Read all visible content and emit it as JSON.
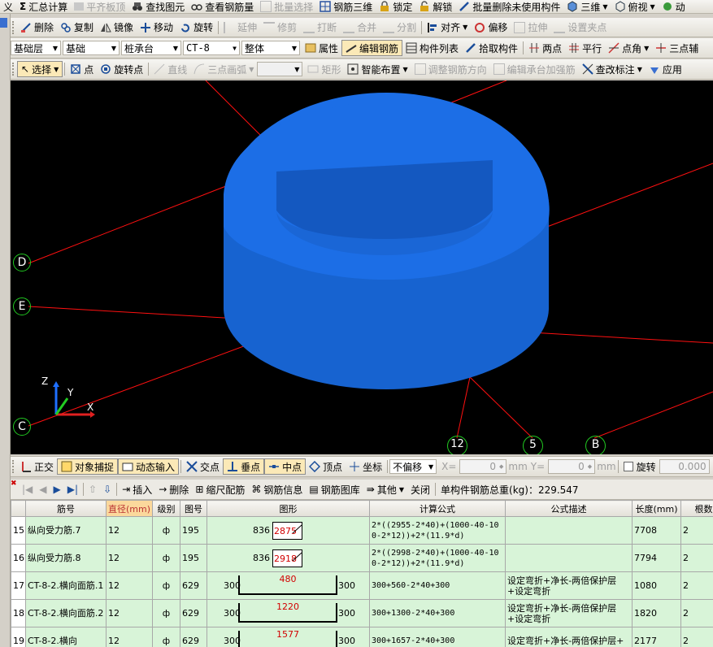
{
  "toolbar1": [
    {
      "label": "义",
      "disabled": false
    },
    {
      "label": "汇总计算",
      "icon": "sigma-icon",
      "disabled": false
    },
    {
      "label": "平齐板顶",
      "disabled": true
    },
    {
      "label": "查找图元",
      "disabled": false
    },
    {
      "label": "查看钢筋量",
      "disabled": false
    },
    {
      "label": "批量选择",
      "disabled": true
    },
    {
      "label": "钢筋三维",
      "disabled": false
    },
    {
      "label": "锁定",
      "disabled": false
    },
    {
      "label": "解锁",
      "disabled": false
    },
    {
      "label": "批量删除未使用构件",
      "disabled": false
    },
    {
      "label": "三维",
      "disabled": false
    },
    {
      "label": "俯视",
      "disabled": false
    },
    {
      "label": "动",
      "disabled": false
    }
  ],
  "toolbar2": [
    {
      "label": "删除",
      "disabled": false
    },
    {
      "label": "复制",
      "disabled": false
    },
    {
      "label": "镜像",
      "disabled": false
    },
    {
      "label": "移动",
      "disabled": false
    },
    {
      "label": "旋转",
      "disabled": false
    },
    {
      "label": "延伸",
      "disabled": true
    },
    {
      "label": "修剪",
      "disabled": true
    },
    {
      "label": "打断",
      "disabled": true
    },
    {
      "label": "合并",
      "disabled": true
    },
    {
      "label": "分割",
      "disabled": true
    },
    {
      "label": "对齐",
      "disabled": false
    },
    {
      "label": "偏移",
      "disabled": false
    },
    {
      "label": "拉伸",
      "disabled": true
    },
    {
      "label": "设置夹点",
      "disabled": true
    }
  ],
  "toolbar3": {
    "selects": [
      "基础层",
      "基础",
      "桩承台",
      "CT-8",
      "整体"
    ],
    "buttons": [
      {
        "label": "属性"
      },
      {
        "label": "编辑钢筋",
        "active": true
      },
      {
        "label": "构件列表"
      },
      {
        "label": "拾取构件"
      },
      {
        "label": "两点"
      },
      {
        "label": "平行"
      },
      {
        "label": "点角"
      },
      {
        "label": "三点辅"
      }
    ]
  },
  "toolbar4": [
    {
      "label": "选择",
      "disabled": false
    },
    {
      "label": "点",
      "disabled": false
    },
    {
      "label": "旋转点",
      "disabled": false
    },
    {
      "label": "直线",
      "disabled": true
    },
    {
      "label": "三点画弧",
      "disabled": true
    },
    {
      "label": "矩形",
      "disabled": true
    },
    {
      "label": "智能布置",
      "disabled": false
    },
    {
      "label": "调整钢筋方向",
      "disabled": true
    },
    {
      "label": "编辑承台加强筋",
      "disabled": true
    },
    {
      "label": "查改标注",
      "disabled": false
    },
    {
      "label": "应用",
      "disabled": false
    }
  ],
  "viewport": {
    "axis_labels": [
      "D",
      "E",
      "C",
      "12",
      "5",
      "B"
    ],
    "gizmo": {
      "x": "X",
      "y": "Y",
      "z": "Z"
    },
    "shape_color": "#1e6fd8"
  },
  "snapbar": {
    "items": [
      "正交",
      "对象捕捉",
      "动态输入",
      "交点",
      "垂点",
      "中点",
      "顶点",
      "坐标"
    ],
    "offset_select": "不偏移",
    "x_label": "X=",
    "x_value": "0",
    "x_unit": "mm",
    "y_label": "Y=",
    "y_value": "0",
    "y_unit": "mm",
    "rotate_label": "旋转",
    "rotate_value": "0.000"
  },
  "rebar_toolbar": {
    "items": [
      "插入",
      "删除",
      "缩尺配筋",
      "钢筋信息",
      "钢筋图库",
      "其他",
      "关闭"
    ],
    "total_label": "单构件钢筋总重(kg)：229.547"
  },
  "table": {
    "columns": [
      "筋号",
      "直径(mm)",
      "级别",
      "图号",
      "图形",
      "计算公式",
      "公式描述",
      "长度(mm)",
      "根数"
    ],
    "rows": [
      {
        "no": "15",
        "name": "纵向受力筋.7",
        "dia": "12",
        "grade": "ф",
        "fig": "195",
        "shape_left": "836",
        "shape_value": "2875",
        "shape_right": "",
        "formula": "2*((2955-2*40)+(1000-40-100-2*12))+2*(11.9*d)",
        "desc": "",
        "len": "7708",
        "count": "2",
        "kind": "hook"
      },
      {
        "no": "16",
        "name": "纵向受力筋.8",
        "dia": "12",
        "grade": "ф",
        "fig": "195",
        "shape_left": "836",
        "shape_value": "2918",
        "shape_right": "",
        "formula": "2*((2998-2*40)+(1000-40-100-2*12))+2*(11.9*d)",
        "desc": "",
        "len": "7794",
        "count": "2",
        "kind": "hook"
      },
      {
        "no": "17",
        "name": "CT-8-2.横向面筋.1",
        "dia": "12",
        "grade": "ф",
        "fig": "629",
        "shape_left": "300",
        "shape_value": "480",
        "shape_right": "300",
        "formula": "300+560-2*40+300",
        "desc": "设定弯折+净长-两倍保护层+设定弯折",
        "len": "1080",
        "count": "2",
        "kind": "bar"
      },
      {
        "no": "18",
        "name": "CT-8-2.横向面筋.2",
        "dia": "12",
        "grade": "ф",
        "fig": "629",
        "shape_left": "300",
        "shape_value": "1220",
        "shape_right": "300",
        "formula": "300+1300-2*40+300",
        "desc": "设定弯折+净长-两倍保护层+设定弯折",
        "len": "1820",
        "count": "2",
        "kind": "bar"
      },
      {
        "no": "19",
        "name": "CT-8-2.横向",
        "dia": "12",
        "grade": "ф",
        "fig": "629",
        "shape_left": "300",
        "shape_value": "1577",
        "shape_right": "300",
        "formula": "300+1657-2*40+300",
        "desc": "设定弯折+净长-两倍保护层+",
        "len": "2177",
        "count": "2",
        "kind": "bar"
      }
    ]
  }
}
